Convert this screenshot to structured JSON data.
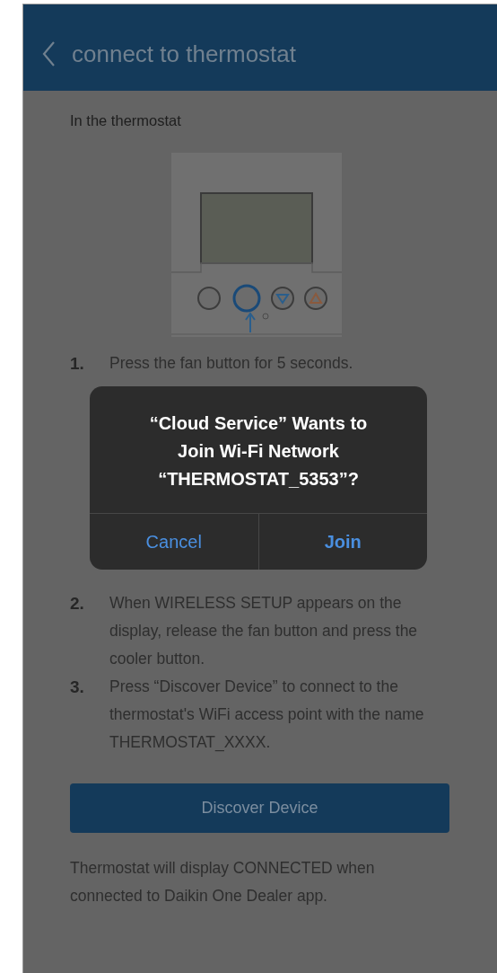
{
  "header": {
    "title": "connect to thermostat"
  },
  "section_title": "In the thermostat",
  "steps": [
    {
      "number": "1.",
      "text": "Press the fan button for 5 seconds."
    },
    {
      "number": "2.",
      "text": "When WIRELESS SETUP appears on the display, release the fan button and press the cooler button."
    },
    {
      "number": "3.",
      "text": "Press “Discover Device” to connect to the thermostat's WiFi access point with the name THERMOSTAT_XXXX."
    }
  ],
  "primary_button": "Discover Device",
  "footer_note": "Thermostat will display CONNECTED when connected to Daikin One Dealer app.",
  "dialog": {
    "title_lines": [
      "“Cloud Service” Wants to",
      "Join Wi-Fi Network",
      "“THERMOSTAT_5353”?"
    ],
    "buttons": [
      {
        "label": "Cancel",
        "kind": "cancel"
      },
      {
        "label": "Join",
        "kind": "confirm"
      }
    ]
  }
}
